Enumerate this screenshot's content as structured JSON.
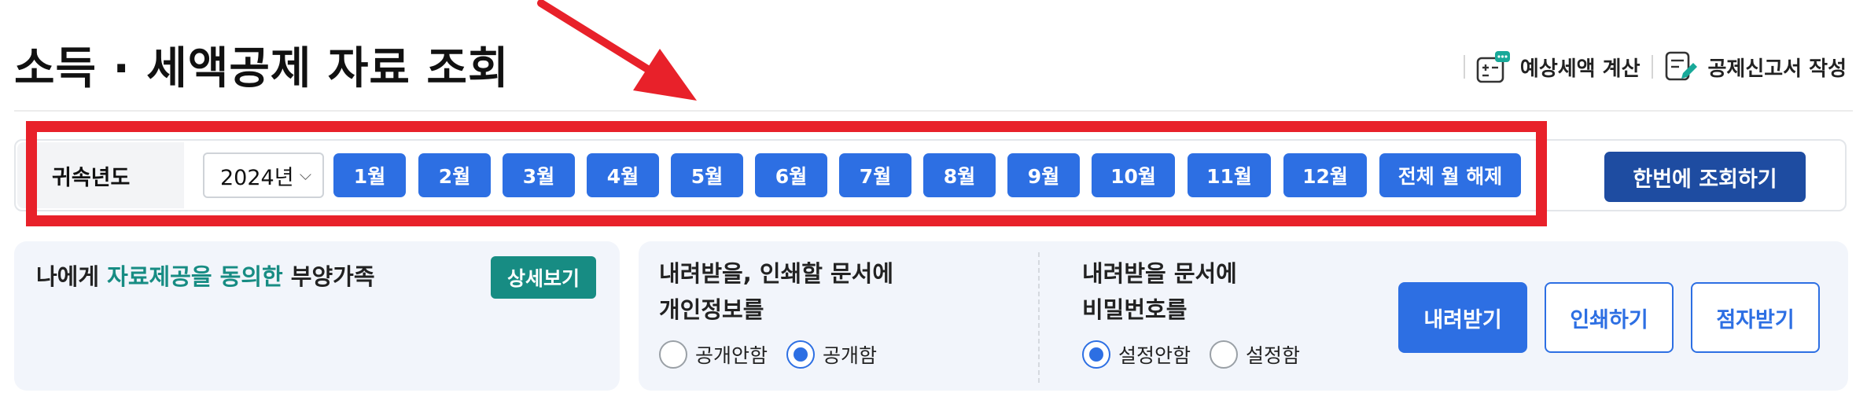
{
  "page": {
    "title": "소득 · 세액공제 자료 조회"
  },
  "header": {
    "links": [
      {
        "label": "예상세액 계산",
        "icon": "calculator-chat-icon"
      },
      {
        "label": "공제신고서 작성",
        "icon": "document-edit-icon"
      }
    ]
  },
  "year_bar": {
    "label": "귀속년도",
    "year_value": "2024년",
    "months": [
      "1월",
      "2월",
      "3월",
      "4월",
      "5월",
      "6월",
      "7월",
      "8월",
      "9월",
      "10월",
      "11월",
      "12월"
    ],
    "clear_all": "전체 월 해제",
    "query_all": "한번에 조회하기"
  },
  "family_panel": {
    "title_prefix": "나에게 ",
    "title_highlight": "자료제공을 동의한",
    "title_suffix": " 부양가족",
    "detail_button": "상세보기"
  },
  "privacy_option": {
    "title_line1": "내려받을, 인쇄할 문서에",
    "title_line2": "개인정보를",
    "options": [
      {
        "label": "공개안함",
        "checked": false
      },
      {
        "label": "공개함",
        "checked": true
      }
    ]
  },
  "password_option": {
    "title_line1": "내려받을 문서에",
    "title_line2": "비밀번호를",
    "options": [
      {
        "label": "설정안함",
        "checked": true
      },
      {
        "label": "설정함",
        "checked": false
      }
    ]
  },
  "actions": {
    "download": "내려받기",
    "print": "인쇄하기",
    "braille": "점자받기"
  },
  "colors": {
    "primary": "#2d6fe3",
    "dark_primary": "#1e4ca1",
    "teal": "#178c83",
    "highlight_box": "#e8212a",
    "panel_bg": "#f2f5fb"
  }
}
